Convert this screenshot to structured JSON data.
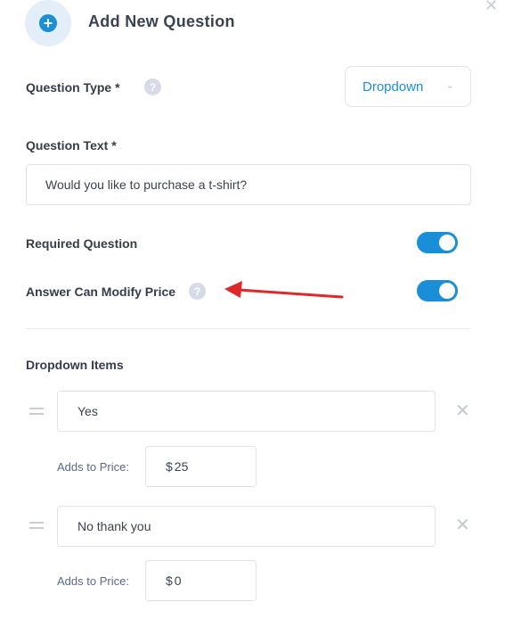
{
  "header": {
    "title": "Add New Question",
    "icon": "plus-circle-icon",
    "close_icon": "close-icon",
    "accent": "#1a8fd8"
  },
  "question_type": {
    "label": "Question Type *",
    "help": "?",
    "value": "Dropdown"
  },
  "question_text": {
    "label": "Question Text *",
    "value": "Would you like to purchase a t-shirt?"
  },
  "required": {
    "label": "Required Question",
    "on": true
  },
  "modify_price": {
    "label": "Answer Can Modify Price",
    "help": "?",
    "on": true
  },
  "dropdown": {
    "label": "Dropdown Items",
    "items": [
      {
        "value": "Yes",
        "price_label": "Adds to Price:",
        "currency": "$",
        "price": "25"
      },
      {
        "value": "No thank you",
        "price_label": "Adds to Price:",
        "currency": "$",
        "price": "0"
      }
    ]
  },
  "annotation": {
    "color": "#e0282a"
  }
}
